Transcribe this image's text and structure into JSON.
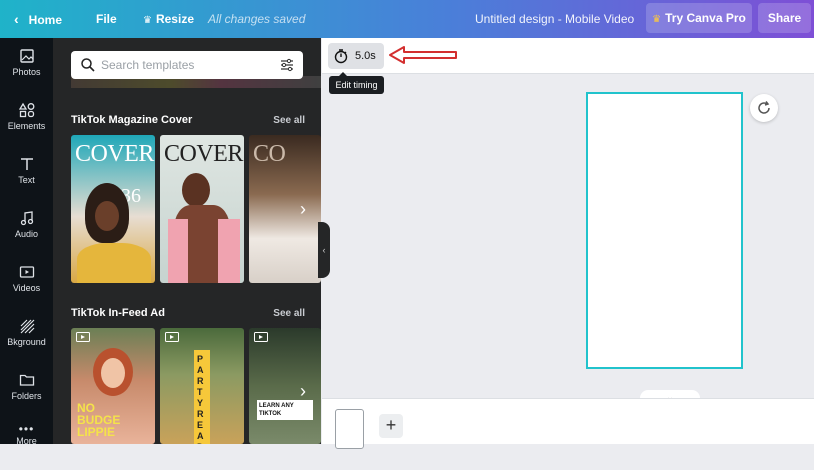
{
  "topbar": {
    "home_label": "Home",
    "file_label": "File",
    "resize_label": "Resize",
    "save_status": "All changes saved",
    "design_title": "Untitled design - Mobile Video",
    "try_pro_label": "Try Canva Pro",
    "share_label": "Share",
    "crown_icon": "crown-icon"
  },
  "sidebar": {
    "items": [
      {
        "label": "Photos",
        "icon": "photos-icon"
      },
      {
        "label": "Elements",
        "icon": "elements-icon"
      },
      {
        "label": "Text",
        "icon": "text-icon"
      },
      {
        "label": "Audio",
        "icon": "audio-icon"
      },
      {
        "label": "Videos",
        "icon": "videos-icon"
      },
      {
        "label": "Bkground",
        "icon": "background-icon"
      },
      {
        "label": "Folders",
        "icon": "folder-icon"
      },
      {
        "label": "More",
        "icon": "more-icon"
      }
    ]
  },
  "panel": {
    "search_placeholder": "Search templates",
    "sections": [
      {
        "title": "TikTok Magazine Cover",
        "see_all": "See all",
        "thumbs": [
          {
            "text": "COVER"
          },
          {
            "text": "COVER"
          },
          {
            "text": "CO"
          }
        ]
      },
      {
        "title": "TikTok In-Feed Ad",
        "see_all": "See all",
        "thumbs": [
          {
            "text": "NO BUDGE LIPPIE"
          },
          {
            "text": "PARTY READY"
          },
          {
            "text": "LEARN ANY TIKTOK"
          }
        ]
      }
    ],
    "cover_number": "36"
  },
  "editor": {
    "timing_value": "5.0s",
    "tooltip": "Edit timing",
    "frame_color": "#21c3cc"
  },
  "colors": {
    "accent": "#21c3cc",
    "annotation_arrow": "#d32f2f"
  }
}
